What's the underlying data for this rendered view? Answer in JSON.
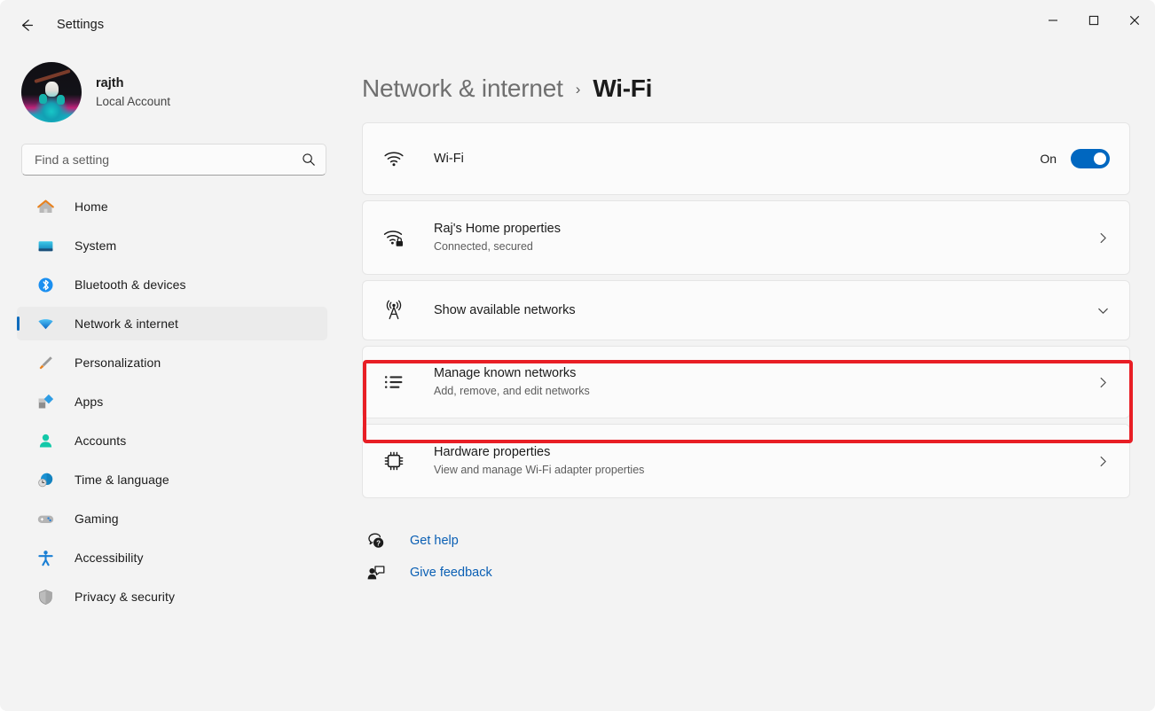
{
  "window": {
    "app_title": "Settings",
    "back_icon": "back-arrow-icon",
    "controls": {
      "minimize": "minimize-icon",
      "maximize": "maximize-icon",
      "close": "close-icon"
    }
  },
  "sidebar": {
    "account": {
      "name": "rajth",
      "type": "Local Account",
      "avatar": "user-avatar"
    },
    "search": {
      "placeholder": "Find a setting",
      "value": "",
      "icon": "search-icon"
    },
    "items": [
      {
        "label": "Home",
        "icon": "home-icon",
        "active": false
      },
      {
        "label": "System",
        "icon": "system-monitor-icon",
        "active": false
      },
      {
        "label": "Bluetooth & devices",
        "icon": "bluetooth-icon",
        "active": false
      },
      {
        "label": "Network & internet",
        "icon": "wifi-icon",
        "active": true
      },
      {
        "label": "Personalization",
        "icon": "paintbrush-icon",
        "active": false
      },
      {
        "label": "Apps",
        "icon": "apps-icon",
        "active": false
      },
      {
        "label": "Accounts",
        "icon": "person-icon",
        "active": false
      },
      {
        "label": "Time & language",
        "icon": "clock-globe-icon",
        "active": false
      },
      {
        "label": "Gaming",
        "icon": "gamepad-icon",
        "active": false
      },
      {
        "label": "Accessibility",
        "icon": "accessibility-icon",
        "active": false
      },
      {
        "label": "Privacy & security",
        "icon": "shield-icon",
        "active": false
      }
    ]
  },
  "main": {
    "breadcrumb": {
      "parent": "Network & internet",
      "separator": "›",
      "current": "Wi-Fi"
    },
    "cards": {
      "wifi_toggle": {
        "title": "Wi-Fi",
        "icon": "wifi-icon",
        "toggle_label": "On",
        "toggle_state": "on"
      },
      "network_properties": {
        "title": "Raj's Home properties",
        "subtitle": "Connected, secured",
        "icon": "wifi-secured-icon",
        "chevron": "chevron-right-icon"
      },
      "show_networks": {
        "title": "Show available networks",
        "icon": "broadcast-tower-icon",
        "chevron": "chevron-down-icon"
      },
      "manage_networks": {
        "title": "Manage known networks",
        "subtitle": "Add, remove, and edit networks",
        "icon": "list-icon",
        "chevron": "chevron-right-icon",
        "highlighted": true
      },
      "hardware_properties": {
        "title": "Hardware properties",
        "subtitle": "View and manage Wi-Fi adapter properties",
        "icon": "cpu-chip-icon",
        "chevron": "chevron-right-icon"
      }
    },
    "links": [
      {
        "label": "Get help",
        "icon": "help-icon"
      },
      {
        "label": "Give feedback",
        "icon": "feedback-icon"
      }
    ]
  },
  "colors": {
    "accent": "#0067c0",
    "highlight_box": "#e81e25",
    "link": "#0a5fb4",
    "page_background": "#f3f3f3",
    "card_background": "#fbfbfb"
  }
}
